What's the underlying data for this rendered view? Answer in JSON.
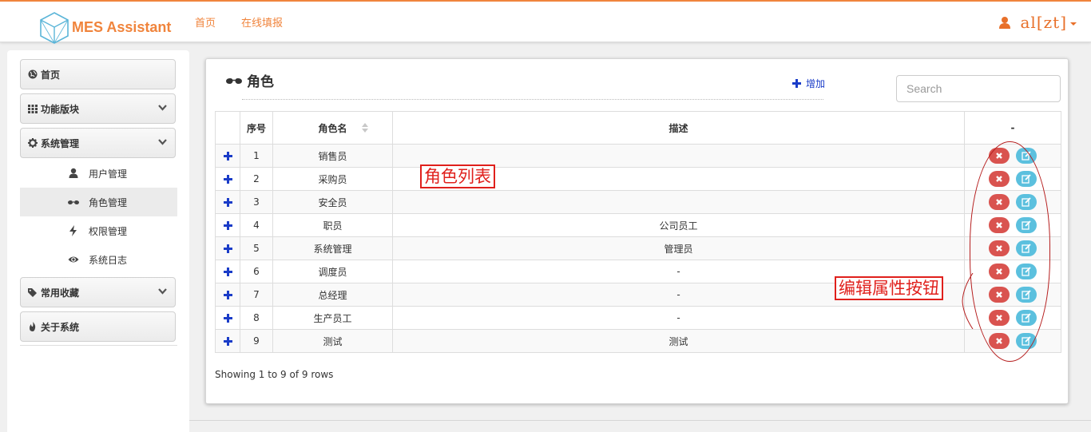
{
  "app": {
    "brand": "MES Assistant",
    "nav": [
      "首页",
      "在线填报"
    ],
    "user": "al[zt]",
    "accent_color": "#f0843c"
  },
  "sidebar": {
    "items": [
      {
        "label": "首页",
        "icon": "globe-icon"
      },
      {
        "label": "功能版块",
        "icon": "grid-icon",
        "expandable": true
      },
      {
        "label": "系统管理",
        "icon": "gear-icon",
        "expandable": true
      },
      {
        "label": "常用收藏",
        "icon": "tags-icon",
        "expandable": true
      },
      {
        "label": "关于系统",
        "icon": "fire-icon"
      }
    ],
    "sub_items": [
      {
        "label": "用户管理",
        "icon": "user-icon"
      },
      {
        "label": "角色管理",
        "icon": "glasses-icon",
        "active": true
      },
      {
        "label": "权限管理",
        "icon": "bolt-icon"
      },
      {
        "label": "系统日志",
        "icon": "eye-icon"
      }
    ]
  },
  "panel": {
    "title": "角色",
    "title_icon": "glasses-icon",
    "add_label": "增加",
    "search_placeholder": "Search",
    "columns": [
      "",
      "序号",
      "角色名",
      "描述",
      "-"
    ],
    "rows": [
      {
        "no": "1",
        "name": "销售员",
        "desc": ""
      },
      {
        "no": "2",
        "name": "采购员",
        "desc": ""
      },
      {
        "no": "3",
        "name": "安全员",
        "desc": ""
      },
      {
        "no": "4",
        "name": "职员",
        "desc": "公司员工"
      },
      {
        "no": "5",
        "name": "系统管理",
        "desc": "管理员"
      },
      {
        "no": "6",
        "name": "调度员",
        "desc": "-"
      },
      {
        "no": "7",
        "name": "总经理",
        "desc": "-"
      },
      {
        "no": "8",
        "name": "生产员工",
        "desc": "-"
      },
      {
        "no": "9",
        "name": "测试",
        "desc": "测试"
      }
    ],
    "pagination": "Showing 1 to 9 of 9 rows"
  },
  "annotations": {
    "role_list": "角色列表",
    "edit_buttons": "编辑属性按钮"
  }
}
